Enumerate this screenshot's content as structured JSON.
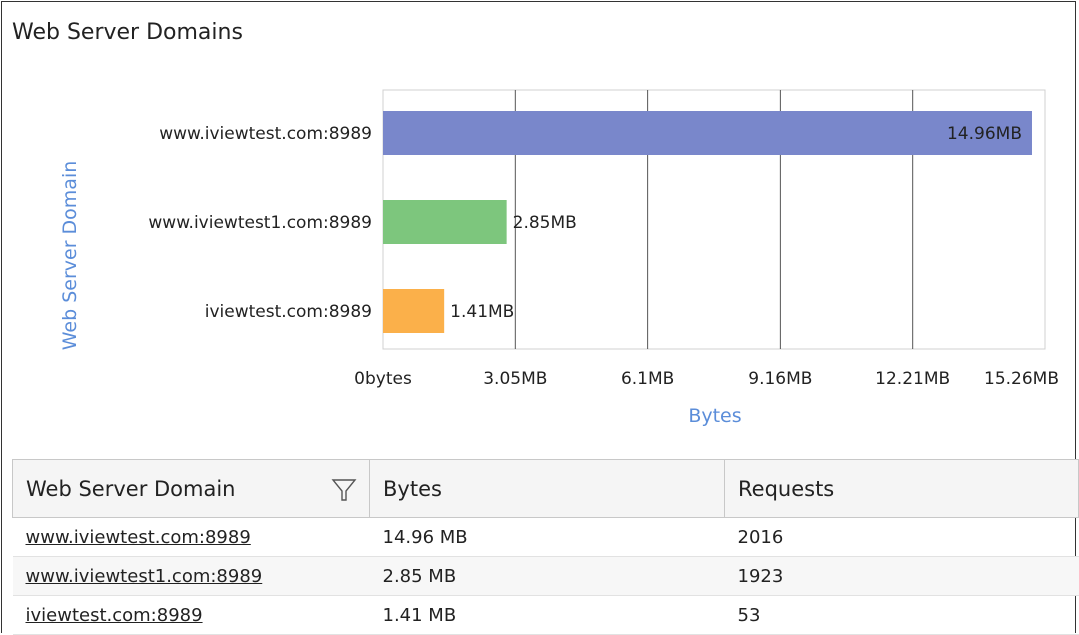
{
  "panel": {
    "title": "Web Server Domains"
  },
  "colors": {
    "series": [
      "#7987cb",
      "#7dc67d",
      "#fbb04a"
    ],
    "axis_title": "#5b8dd9",
    "grid": "#555555"
  },
  "chart_data": {
    "type": "bar",
    "orientation": "horizontal",
    "categories": [
      "www.iviewtest.com:8989",
      "www.iviewtest1.com:8989",
      "iviewtest.com:8989"
    ],
    "values": [
      14.96,
      2.85,
      1.41
    ],
    "value_unit": "MB",
    "data_labels": [
      "14.96MB",
      "2.85MB",
      "1.41MB"
    ],
    "xlabel": "Bytes",
    "ylabel": "Web Server Domain",
    "xlim": [
      0,
      15.26
    ],
    "x_ticks": [
      {
        "value": 0,
        "label": "0bytes"
      },
      {
        "value": 3.05,
        "label": "3.05MB"
      },
      {
        "value": 6.1,
        "label": "6.1MB"
      },
      {
        "value": 9.16,
        "label": "9.16MB"
      },
      {
        "value": 12.21,
        "label": "12.21MB"
      },
      {
        "value": 15.26,
        "label": "15.26MB"
      }
    ],
    "grid": true,
    "legend": "none"
  },
  "table": {
    "columns": [
      "Web Server Domain",
      "Bytes",
      "Requests"
    ],
    "rows": [
      {
        "domain": "www.iviewtest.com:8989",
        "bytes": "14.96 MB",
        "requests": "2016"
      },
      {
        "domain": "www.iviewtest1.com:8989",
        "bytes": "2.85 MB",
        "requests": "1923"
      },
      {
        "domain": "iviewtest.com:8989",
        "bytes": "1.41 MB",
        "requests": "53"
      }
    ],
    "filter_icon": "filter-icon"
  }
}
